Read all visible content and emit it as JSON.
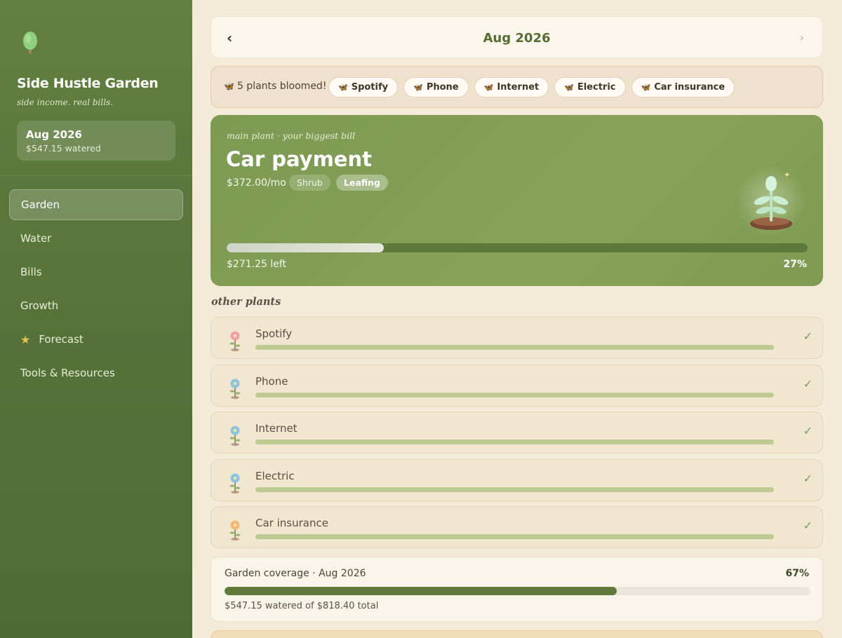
{
  "sidebar": {
    "app_title": "Side Hustle Garden",
    "tagline": "side income. real bills.",
    "month_card": {
      "title": "Aug 2026",
      "subtitle": "$547.15 watered"
    },
    "nav": [
      {
        "label": "Garden",
        "active": true
      },
      {
        "label": "Water",
        "active": false
      },
      {
        "label": "Bills",
        "active": false
      },
      {
        "label": "Growth",
        "active": false
      },
      {
        "label": "Forecast",
        "active": false,
        "icon": "star-icon"
      },
      {
        "label": "Tools & Resources",
        "active": false
      }
    ]
  },
  "month_nav": {
    "prev": "‹",
    "label": "Aug 2026",
    "next": "›"
  },
  "bloom": {
    "text": "5 plants bloomed!",
    "chips": [
      "Spotify",
      "Phone",
      "Internet",
      "Electric",
      "Car insurance"
    ]
  },
  "main_plant": {
    "caption": "main plant · your biggest bill",
    "name": "Car payment",
    "amount": "$372.00/mo",
    "type_tag": "Shrub",
    "stage_tag": "Leafing",
    "progress": 0.27,
    "left_text": "$271.25 left",
    "percent_text": "27%"
  },
  "other_plants": {
    "title": "other plants",
    "items": [
      {
        "name": "Spotify",
        "flower_color": "#f0a0a0",
        "progress": 1.0,
        "check": "✓"
      },
      {
        "name": "Phone",
        "flower_color": "#8cc4e0",
        "progress": 1.0,
        "check": "✓"
      },
      {
        "name": "Internet",
        "flower_color": "#8cc4e0",
        "progress": 1.0,
        "check": "✓"
      },
      {
        "name": "Electric",
        "flower_color": "#8cc4e0",
        "progress": 1.0,
        "check": "✓"
      },
      {
        "name": "Car insurance",
        "flower_color": "#f2b878",
        "progress": 1.0,
        "check": "✓"
      }
    ]
  },
  "coverage": {
    "title": "Garden coverage · Aug 2026",
    "percent_text": "67%",
    "progress": 0.67,
    "subtitle": "$547.15 watered of $818.40 total"
  },
  "colors": {
    "sidebar": "#5a7a3c",
    "accent": "#5f7a3a",
    "main_plant_card": "#84a057",
    "butterfly": "#b073c7"
  }
}
